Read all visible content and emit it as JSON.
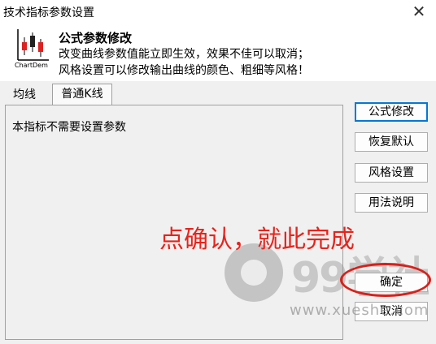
{
  "window": {
    "title": "技术指标参数设置",
    "close_glyph": "✕"
  },
  "header": {
    "logo_text": "ChartDem",
    "title": "公式参数修改",
    "line1": "改变曲线参数值能立即生效，效果不佳可以取消；",
    "line2": "风格设置可以修改输出曲线的颜色、粗细等风格！"
  },
  "tabs": [
    {
      "label": "均线",
      "active": false
    },
    {
      "label": "普通K线",
      "active": true
    }
  ],
  "content": {
    "message": "本指标不需要设置参数"
  },
  "buttons": {
    "formula_edit": "公式修改",
    "restore_default": "恢复默认",
    "style_settings": "风格设置",
    "usage_help": "用法说明",
    "ok": "确定",
    "cancel": "取消"
  },
  "annotation": {
    "text": "点确认，就此完成",
    "color": "#e8231b"
  },
  "watermark": {
    "brand": "99学社",
    "url": "www.xueshe.com"
  }
}
